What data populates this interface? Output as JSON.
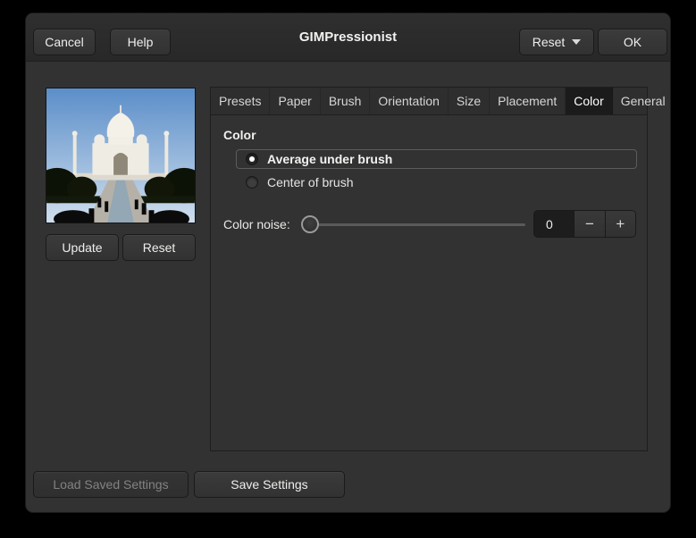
{
  "window": {
    "title": "GIMPressionist"
  },
  "header": {
    "cancel_label": "Cancel",
    "help_label": "Help",
    "reset_menu_label": "Reset",
    "ok_label": "OK"
  },
  "preview": {
    "update_label": "Update",
    "reset_label": "Reset"
  },
  "tabs": [
    {
      "label": "Presets",
      "active": false
    },
    {
      "label": "Paper",
      "active": false
    },
    {
      "label": "Brush",
      "active": false
    },
    {
      "label": "Orientation",
      "active": false
    },
    {
      "label": "Size",
      "active": false
    },
    {
      "label": "Placement",
      "active": false
    },
    {
      "label": "Color",
      "active": true
    },
    {
      "label": "General",
      "active": false
    }
  ],
  "color_panel": {
    "heading": "Color",
    "options": [
      {
        "label": "Average under brush",
        "selected": true
      },
      {
        "label": "Center of brush",
        "selected": false
      }
    ],
    "noise_label": "Color noise:",
    "noise_value": "0",
    "noise_min_handle_position": "left",
    "spin_minus": "−",
    "spin_plus": "+"
  },
  "footer": {
    "load_label": "Load Saved Settings",
    "load_enabled": false,
    "save_label": "Save Settings"
  },
  "colors": {
    "canvas_bg": "#000000",
    "dialog_bg": "#323232",
    "headerbar_bg": "#2b2b2b",
    "button_bg": "#363636",
    "active_tab_bg": "#1b1b1b",
    "entry_bg": "#1d1d1d",
    "text": "#eeeeec",
    "disabled_text": "#828280",
    "frame_border": "#5c5c5c"
  }
}
